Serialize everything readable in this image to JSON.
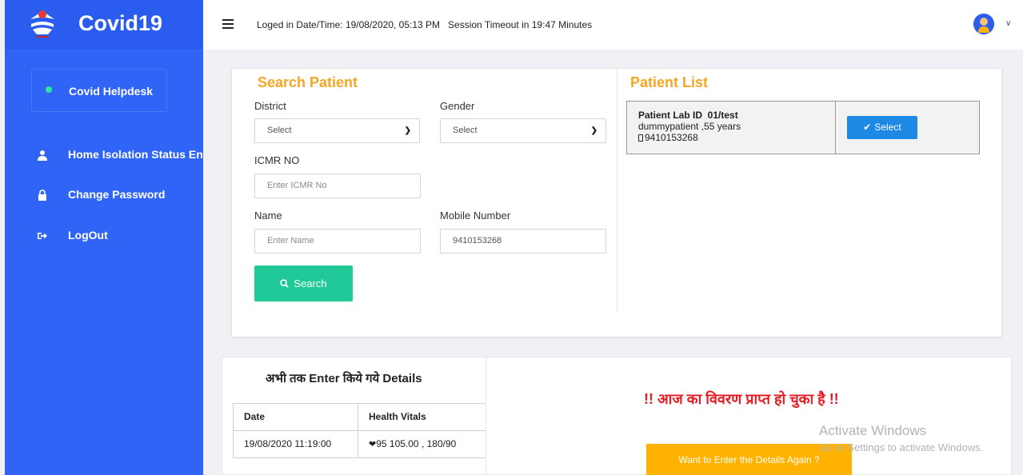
{
  "app": {
    "name": "Covid19"
  },
  "header": {
    "login_info": "Loged in Date/Time: 19/08/2020, 05:13 PM   Session Timeout in 19:47 Minutes"
  },
  "sidebar": {
    "helpdesk": "Covid Helpdesk",
    "items": [
      {
        "label": "Home Isolation Status Entry",
        "icon": "user-icon"
      },
      {
        "label": "Change Password",
        "icon": "lock-icon"
      },
      {
        "label": "LogOut",
        "icon": "sign-out-icon"
      }
    ]
  },
  "search": {
    "title": "Search Patient",
    "district_label": "District",
    "district_value": "Select",
    "gender_label": "Gender",
    "gender_value": "Select",
    "icmr_label": "ICMR NO",
    "icmr_placeholder": "Enter ICMR No",
    "name_label": "Name",
    "name_placeholder": "Enter Name",
    "mobile_label": "Mobile Number",
    "mobile_value": "9410153268",
    "button": "Search"
  },
  "patient_list": {
    "title": "Patient List",
    "items": [
      {
        "lab_id": "Patient Lab ID  01/test",
        "name_age": "dummypatient ,55 years",
        "mobile": "9410153268",
        "button": "Select"
      }
    ]
  },
  "details": {
    "title": "अभी तक Enter किये गये Details",
    "columns": [
      "Date",
      "Health Vitals"
    ],
    "rows": [
      {
        "date": "19/08/2020 11:19:00",
        "vitals": "95 105.00 , 180/90"
      }
    ],
    "received_msg": "!! आज का विवरण प्राप्त हो चुका है !!",
    "again_button": "Want to Enter the Details Again ?"
  },
  "watermark": {
    "line1": "Activate Windows",
    "line2": "Go to Settings to activate Windows."
  },
  "colors": {
    "sidebar": "#2f64f6",
    "accent_orange": "#f5a623",
    "search_green": "#20c997",
    "select_blue": "#1e88e5",
    "alert_red": "#e51c23",
    "again_yellow": "#ffb300"
  }
}
